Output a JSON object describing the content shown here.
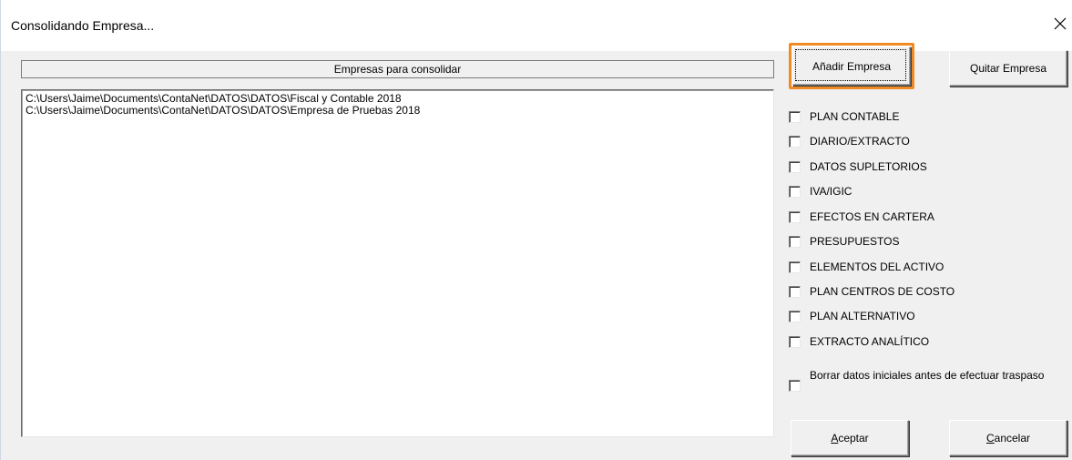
{
  "window": {
    "title": "Consolidando Empresa..."
  },
  "list": {
    "header": "Empresas para consolidar",
    "items": [
      "C:\\Users\\Jaime\\Documents\\ContaNet\\DATOS\\DATOS\\Fiscal y Contable 2018",
      "C:\\Users\\Jaime\\Documents\\ContaNet\\DATOS\\DATOS\\Empresa de Pruebas 2018"
    ]
  },
  "buttons": {
    "add": "Añadir Empresa",
    "remove": "Quitar Empresa",
    "accept_prefix": "",
    "accept_mnemonic": "A",
    "accept_rest": "ceptar",
    "cancel_mnemonic": "C",
    "cancel_rest": "ancelar"
  },
  "options": [
    {
      "label": "PLAN CONTABLE",
      "checked": false
    },
    {
      "label": "DIARIO/EXTRACTO",
      "checked": false
    },
    {
      "label": "DATOS SUPLETORIOS",
      "checked": false
    },
    {
      "label": "IVA/IGIC",
      "checked": false
    },
    {
      "label": "EFECTOS EN CARTERA",
      "checked": false
    },
    {
      "label": "PRESUPUESTOS",
      "checked": false
    },
    {
      "label": "ELEMENTOS DEL ACTIVO",
      "checked": false
    },
    {
      "label": "PLAN CENTROS DE COSTO",
      "checked": false
    },
    {
      "label": "PLAN ALTERNATIVO",
      "checked": false
    },
    {
      "label": "EXTRACTO ANALÍTICO",
      "checked": false
    }
  ],
  "delete_initial": {
    "label": "Borrar datos iniciales antes de efectuar traspaso",
    "checked": false
  },
  "colors": {
    "focus_highlight": "#f08a24",
    "dialog_bg": "#f0f0f0"
  }
}
